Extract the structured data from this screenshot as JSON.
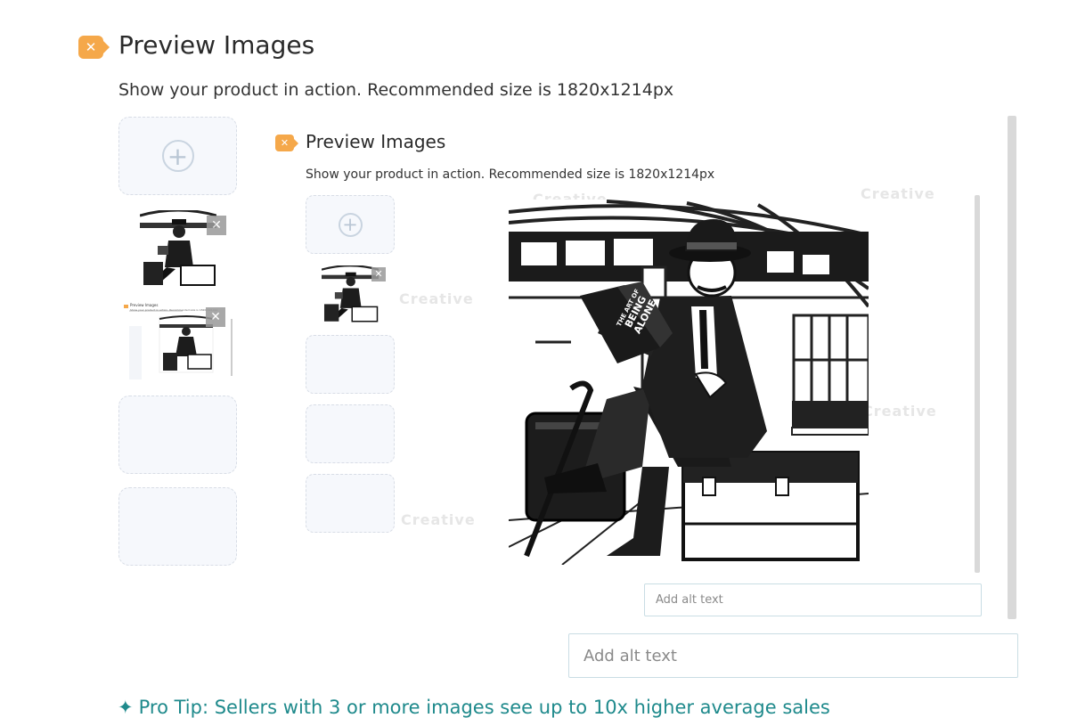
{
  "outer": {
    "title": "Preview Images",
    "subtitle": "Show your product in action. Recommended size is 1820x1214px",
    "alt_placeholder": "Add alt text",
    "pro_tip": "Pro Tip: Sellers with 3 or more images see up to 10x higher average sales"
  },
  "inner": {
    "title": "Preview Images",
    "subtitle": "Show your product in action. Recommended size is 1820x1214px",
    "alt_placeholder": "Add alt text"
  },
  "book": {
    "line1": "THE ART OF",
    "line2": "BEING",
    "line3": "ALONE"
  },
  "mini": {
    "title": "Preview Images",
    "subtitle": "Show your product in action. Recommended size is 1820x1214px"
  },
  "watermark": "Creative",
  "icons": {
    "badge": "close-x-icon",
    "add": "plus-circle-icon",
    "remove": "close-icon",
    "star": "star-icon"
  },
  "colors": {
    "badge": "#f5a84a",
    "pro_tip": "#1f8a8c",
    "slot_bg": "#f6f8fc"
  }
}
